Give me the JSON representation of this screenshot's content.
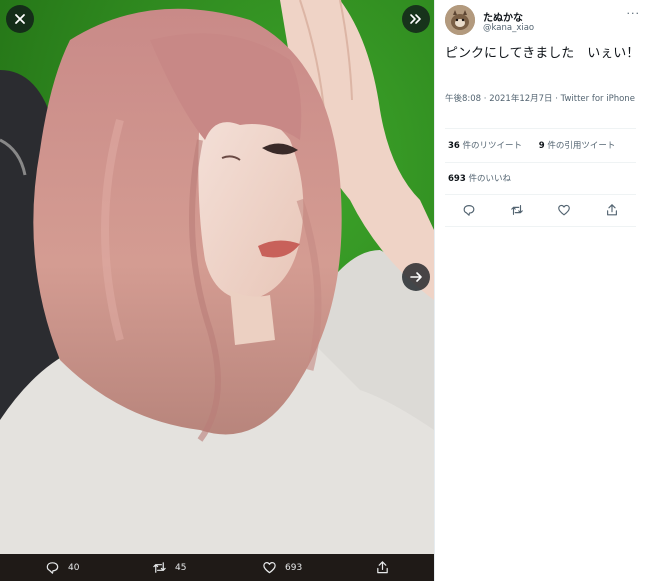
{
  "tweet": {
    "display_name": "たぬかな",
    "handle": "@kana_xiao",
    "text": "ピンクにしてきました　いぇい！",
    "timestamp": "午後8:08 · 2021年12月7日 · ",
    "source": "Twitter for iPhone",
    "retweets": {
      "count": "36",
      "label": " 件のリツイート"
    },
    "quotes": {
      "count": "9",
      "label": " 件の引用ツイート"
    },
    "likes": {
      "count": "693",
      "label": " 件のいいね"
    },
    "more_label": "···"
  },
  "media_bar": {
    "reply_count": "40",
    "retweet_count": "45",
    "like_count": "693"
  },
  "icons": {
    "close": "close-icon",
    "expand": "double-chevron-right-icon",
    "next": "arrow-right-icon",
    "reply": "reply-icon",
    "retweet": "retweet-icon",
    "like": "heart-icon",
    "share": "share-icon"
  },
  "colors": {
    "background_green": "#2e8f1e",
    "media_bar": "#1f1a17",
    "text_primary": "#0f1419",
    "text_secondary": "#536471"
  }
}
